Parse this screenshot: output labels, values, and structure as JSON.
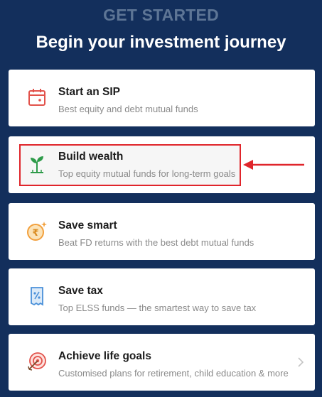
{
  "header": {
    "eyebrow": "GET STARTED",
    "title": "Begin your investment journey"
  },
  "cards": [
    {
      "title": "Start an SIP",
      "subtitle": "Best equity and debt mutual funds",
      "icon": "calendar-icon"
    },
    {
      "title": "Build wealth",
      "subtitle": "Top equity mutual funds for long-term goals",
      "icon": "sprout-icon",
      "highlighted": true
    },
    {
      "title": "Save smart",
      "subtitle": "Beat FD returns with the best debt mutual funds",
      "icon": "rupee-coin-icon"
    },
    {
      "title": "Save tax",
      "subtitle": "Top ELSS funds — the smartest way to save tax",
      "icon": "tax-receipt-icon"
    },
    {
      "title": "Achieve life goals",
      "subtitle": "Customised plans for retirement, child education & more",
      "icon": "target-icon"
    }
  ],
  "colors": {
    "background": "#132f5c",
    "annotation": "#e0252b",
    "icon_green": "#2e9b4a",
    "icon_red": "#e2524b",
    "icon_orange": "#f2a03d",
    "icon_blue": "#4a90d9"
  }
}
